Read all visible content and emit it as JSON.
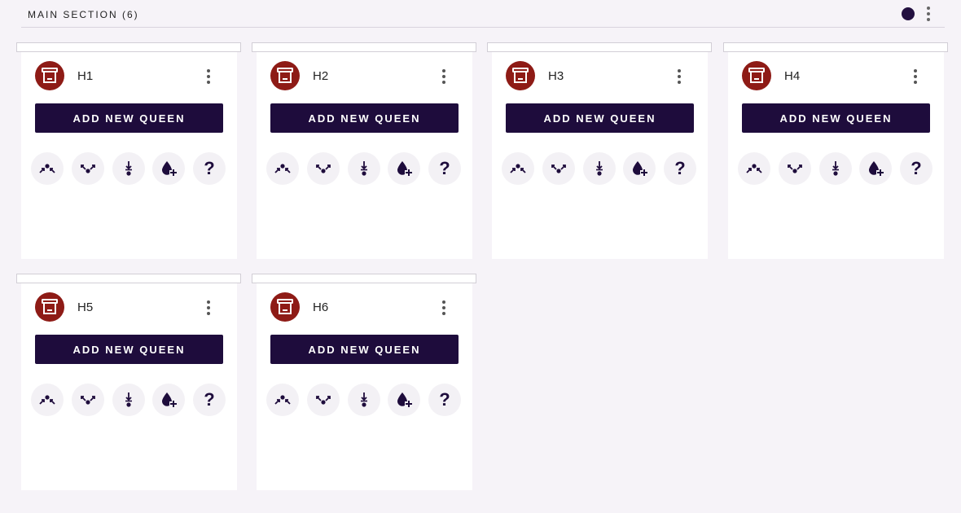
{
  "section": {
    "title": "MAIN SECTION (6)"
  },
  "colors": {
    "primary": "#1e0c3c",
    "hive_badge": "#8e1b16",
    "background": "#f6f3f8"
  },
  "hives": [
    {
      "name": "H1",
      "button_label": "ADD NEW QUEEN"
    },
    {
      "name": "H2",
      "button_label": "ADD NEW QUEEN"
    },
    {
      "name": "H3",
      "button_label": "ADD NEW QUEEN"
    },
    {
      "name": "H4",
      "button_label": "ADD NEW QUEEN"
    },
    {
      "name": "H5",
      "button_label": "ADD NEW QUEEN"
    },
    {
      "name": "H6",
      "button_label": "ADD NEW QUEEN"
    }
  ],
  "actions": [
    {
      "icon": "merge-arrows-icon"
    },
    {
      "icon": "split-arrows-icon"
    },
    {
      "icon": "move-down-icon"
    },
    {
      "icon": "drop-plus-icon"
    },
    {
      "icon": "question-icon",
      "glyph": "?"
    }
  ]
}
